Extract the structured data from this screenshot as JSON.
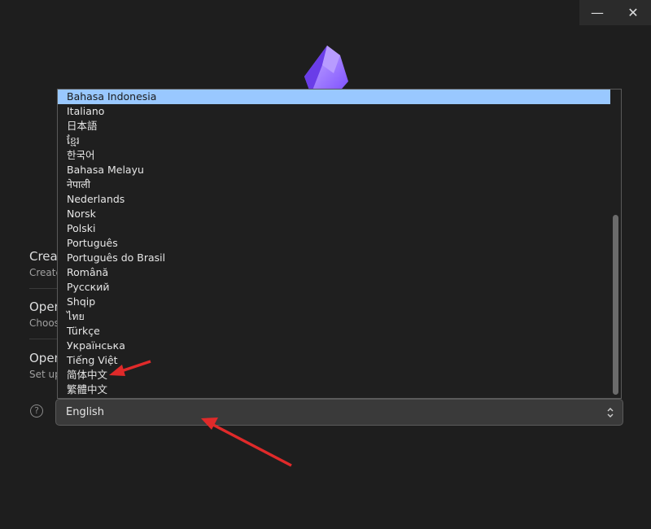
{
  "window_controls": {
    "minimize_glyph": "—",
    "close_glyph": "✕"
  },
  "options": [
    {
      "title": "Create new vault",
      "description": "Create a new Obsidian vault under a folder."
    },
    {
      "title": "Open folder as vault",
      "description": "Choose an existing folder of Markdown files."
    },
    {
      "title": "Open vault from Obsidian Sync",
      "description": "Set up a synced vault with an existing remote vault."
    }
  ],
  "help_glyph": "?",
  "language_list": [
    "Bahasa Indonesia",
    "Italiano",
    "日本語",
    "ខ្មែរ",
    "한국어",
    "Bahasa Melayu",
    "नेपाली",
    "Nederlands",
    "Norsk",
    "Polski",
    "Português",
    "Português do Brasil",
    "Română",
    "Русский",
    "Shqip",
    "ไทย",
    "Türkçe",
    "Українська",
    "Tiếng Việt",
    "简体中文",
    "繁體中文"
  ],
  "highlighted_index": 0,
  "language_select": {
    "value": "English"
  },
  "colors": {
    "background": "#1e1e1e",
    "highlight": "#99c8ff",
    "logo_purple": "#8b6cef",
    "annotation_red": "#e02a2a"
  }
}
